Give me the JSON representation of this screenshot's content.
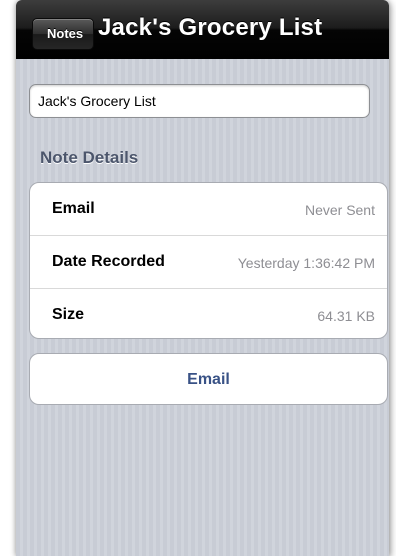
{
  "nav": {
    "back_label": "Notes",
    "title": "Jack's Grocery List"
  },
  "title_field": {
    "value": "Jack's Grocery List"
  },
  "section": {
    "header": "Note Details"
  },
  "details": [
    {
      "label": "Email",
      "value": "Never Sent"
    },
    {
      "label": "Date Recorded",
      "value": "Yesterday 1:36:42 PM"
    },
    {
      "label": "Size",
      "value": "64.31 KB"
    }
  ],
  "actions": {
    "email_label": "Email"
  },
  "colors": {
    "nav_bar": "#000000",
    "section_header": "#4c566c",
    "action_text": "#395286",
    "detail_value": "#8e8e93"
  }
}
